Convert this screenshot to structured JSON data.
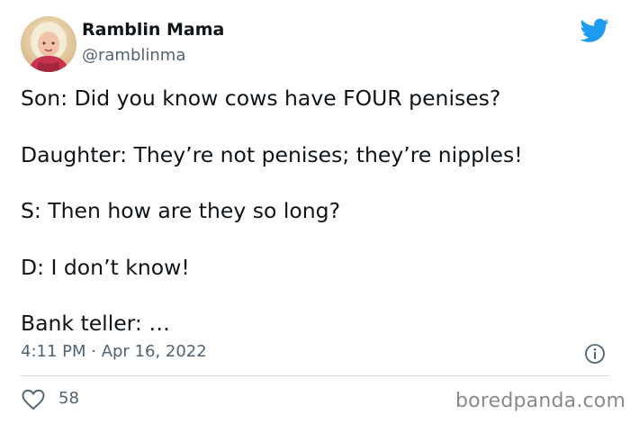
{
  "author": {
    "display_name": "Ramblin Mama",
    "handle": "@ramblinma"
  },
  "tweet": {
    "lines": [
      "Son: Did you know cows have FOUR penises?",
      "Daughter: They’re not penises; they’re nipples!",
      "S: Then how are they so long?",
      "D: I don’t know!",
      "Bank teller: …"
    ],
    "timestamp": "4:11 PM · Apr 16, 2022"
  },
  "engagement": {
    "likes": "58"
  },
  "watermark": "boredpanda.com",
  "icons": {
    "brand": "twitter-bird-icon",
    "info": "info-icon",
    "like": "heart-icon"
  },
  "colors": {
    "twitter_blue": "#1d9bf0",
    "text_primary": "#0f1419",
    "text_secondary": "#536471"
  }
}
